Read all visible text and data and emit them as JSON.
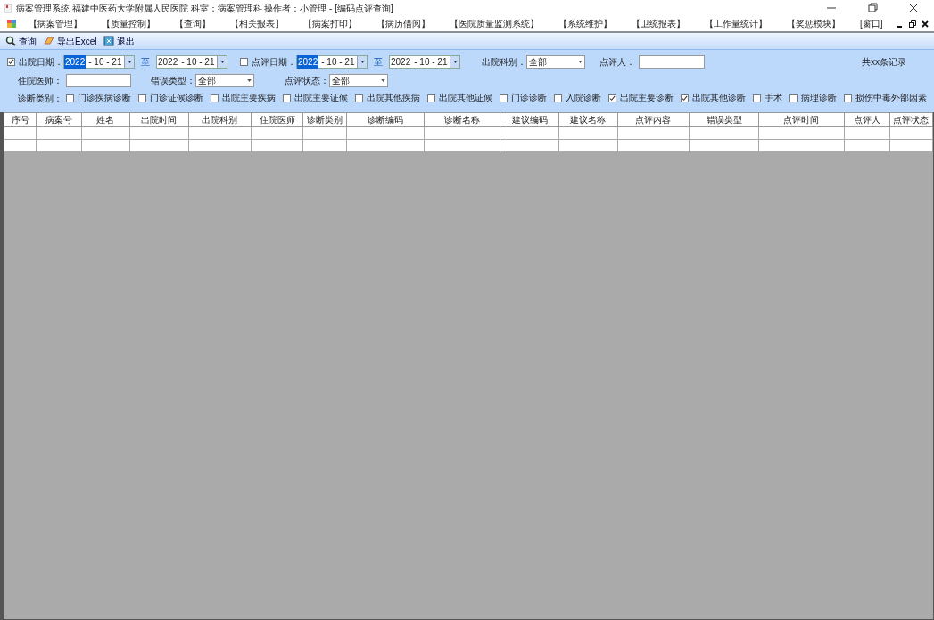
{
  "window": {
    "title": "病案管理系统  福建中医药大学附属人民医院  科室：病案管理科  操作者：小管理 - [编码点评查询]"
  },
  "menu": [
    "【病案管理】",
    "【质量控制】",
    "【查询】",
    "【相关报表】",
    "【病案打印】",
    "【病历借阅】",
    "【医院质量监测系统】",
    "【系统维护】",
    "【卫统报表】",
    "【工作量统计】",
    "【奖惩模块】",
    "[窗口]"
  ],
  "toolbar": [
    {
      "kind": "search",
      "label": "查询"
    },
    {
      "kind": "export",
      "label": "导出Excel"
    },
    {
      "kind": "exit",
      "label": "退出"
    }
  ],
  "filters": {
    "discharge_date": {
      "checked": true,
      "label": "出院日期：",
      "from": {
        "year": "2022",
        "rest": "- 10 - 21",
        "year_selected": true
      },
      "to_label": "至",
      "to": {
        "year": "2022",
        "rest": "- 10 - 21",
        "year_selected": false
      }
    },
    "review_date": {
      "checked": false,
      "label": "点评日期：",
      "from": {
        "year": "2022",
        "rest": "- 10 - 21",
        "year_selected": true
      },
      "to_label": "至",
      "to": {
        "year": "2022",
        "rest": "- 10 - 21",
        "year_selected": false
      }
    },
    "discharge_dept": {
      "label": "出院科别：",
      "value": "全部"
    },
    "reviewer": {
      "label": "点评人："
    },
    "record_count": "共xx条记录",
    "doctor": {
      "label": "住院医师："
    },
    "error_type": {
      "label": "错误类型：",
      "value": "全部"
    },
    "review_status": {
      "label": "点评状态：",
      "value": "全部"
    },
    "diagnosis_category": {
      "label": "诊断类别：",
      "options": [
        {
          "label": "门诊疾病诊断",
          "checked": false
        },
        {
          "label": "门诊证候诊断",
          "checked": false
        },
        {
          "label": "出院主要疾病",
          "checked": false
        },
        {
          "label": "出院主要证候",
          "checked": false
        },
        {
          "label": "出院其他疾病",
          "checked": false
        },
        {
          "label": "出院其他证候",
          "checked": false
        },
        {
          "label": "门诊诊断",
          "checked": false
        },
        {
          "label": "入院诊断",
          "checked": false
        },
        {
          "label": "出院主要诊断",
          "checked": true
        },
        {
          "label": "出院其他诊断",
          "checked": true
        },
        {
          "label": "手术",
          "checked": false
        },
        {
          "label": "病理诊断",
          "checked": false
        },
        {
          "label": "损伤中毒外部因素",
          "checked": false
        }
      ]
    }
  },
  "table": {
    "columns": [
      "序号",
      "病案号",
      "姓名",
      "出院时间",
      "出院科别",
      "住院医师",
      "诊断类别",
      "诊断编码",
      "诊断名称",
      "建议编码",
      "建议名称",
      "点评内容",
      "错误类型",
      "点评时间",
      "点评人",
      "点评状态"
    ]
  }
}
